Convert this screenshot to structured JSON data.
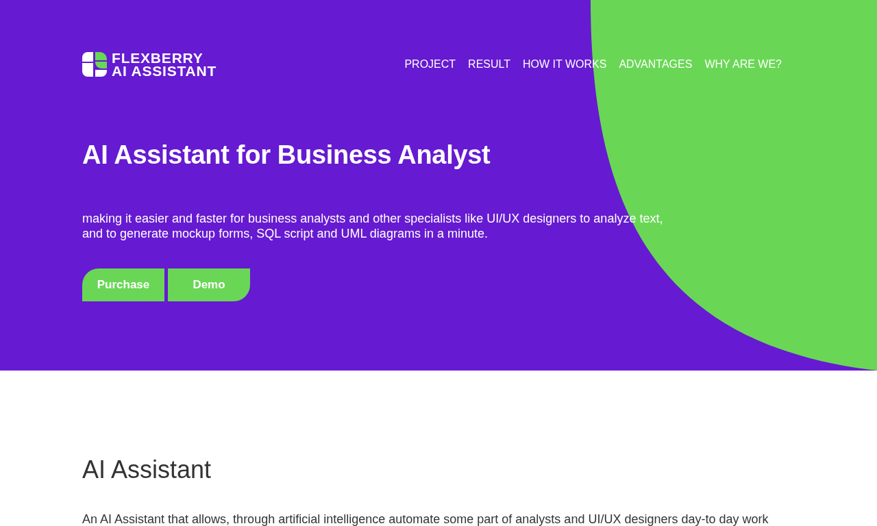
{
  "logo": {
    "lines": [
      "FLEXBERRY",
      "AI ASSISTANT"
    ]
  },
  "nav": {
    "links": [
      "PROJECT",
      "RESULT",
      "HOW IT WORKS",
      "ADVANTAGES",
      "WHY ARE WE?"
    ]
  },
  "hero": {
    "title": "AI Assistant for Business Analyst",
    "subtitle": "making it easier and faster for business analysts and other specialists like UI/UX designers to analyze text,\nand to generate mockup forms, SQL script and UML diagrams in a minute.",
    "buttons": [
      {
        "label": "Purchase",
        "kind": "left"
      },
      {
        "label": "Demo",
        "kind": "right"
      }
    ]
  },
  "about": {
    "title": "AI Assistant",
    "text": "An AI Assistant that allows, through artificial intelligence automate some part of analysts and UI/UX designers day-to day work"
  }
}
